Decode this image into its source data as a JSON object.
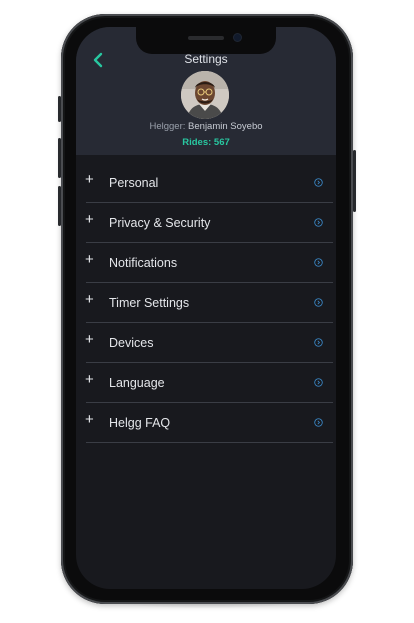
{
  "header": {
    "title": "Settings",
    "user_role": "Helgger:",
    "user_name": "Benjamin Soyebo",
    "rides": "Rides: 567"
  },
  "menu": {
    "items": [
      {
        "label": "Personal"
      },
      {
        "label": "Privacy & Security"
      },
      {
        "label": "Notifications"
      },
      {
        "label": "Timer Settings"
      },
      {
        "label": "Devices"
      },
      {
        "label": "Language"
      },
      {
        "label": "Helgg FAQ"
      }
    ],
    "expand_symbol": "+"
  },
  "colors": {
    "accent": "#28c7a0",
    "chevron": "#3d8fd1",
    "background": "#18191e",
    "header": "#272a34"
  },
  "icons": {
    "back": "chevron-left-icon",
    "item_arrow": "circle-chevron-right-icon"
  }
}
